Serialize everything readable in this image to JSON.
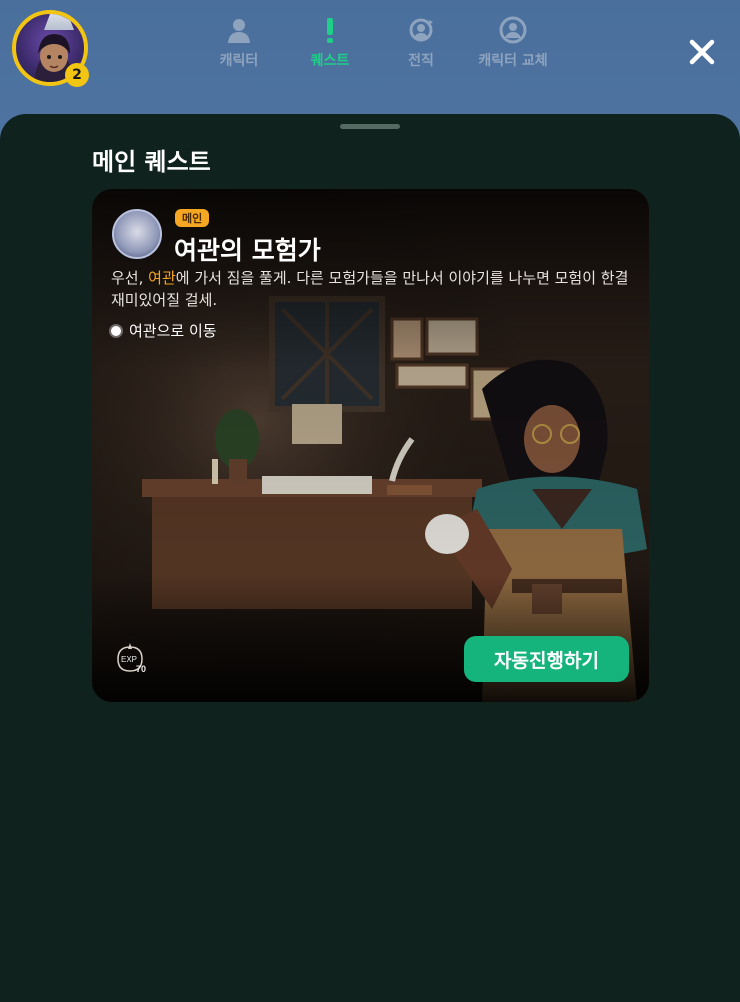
{
  "player": {
    "level": "2"
  },
  "tabs": [
    {
      "label": "캐릭터",
      "icon": "person-icon",
      "active": false
    },
    {
      "label": "퀘스트",
      "icon": "exclamation-icon",
      "active": true
    },
    {
      "label": "전직",
      "icon": "class-change-icon",
      "active": false
    },
    {
      "label": "캐릭터 교체",
      "icon": "swap-character-icon",
      "active": false
    }
  ],
  "section": {
    "title": "메인 퀘스트"
  },
  "quest": {
    "tag": "메인",
    "title": "여관의 모험가",
    "desc_before": "우선, ",
    "desc_highlight": "여관",
    "desc_after": "에 가서 짐을 풀게. 다른 모험가들을 만나서 이야기를 나누면 모험이 한결 재미있어질 걸세.",
    "objective": "여관으로 이동",
    "exp_label": "EXP",
    "exp_value": "70",
    "auto_button": "자동진행하기"
  },
  "colors": {
    "accent": "#1fcf88",
    "highlight": "#f5a623",
    "sheet": "#0f221d",
    "button": "#14b47c"
  }
}
